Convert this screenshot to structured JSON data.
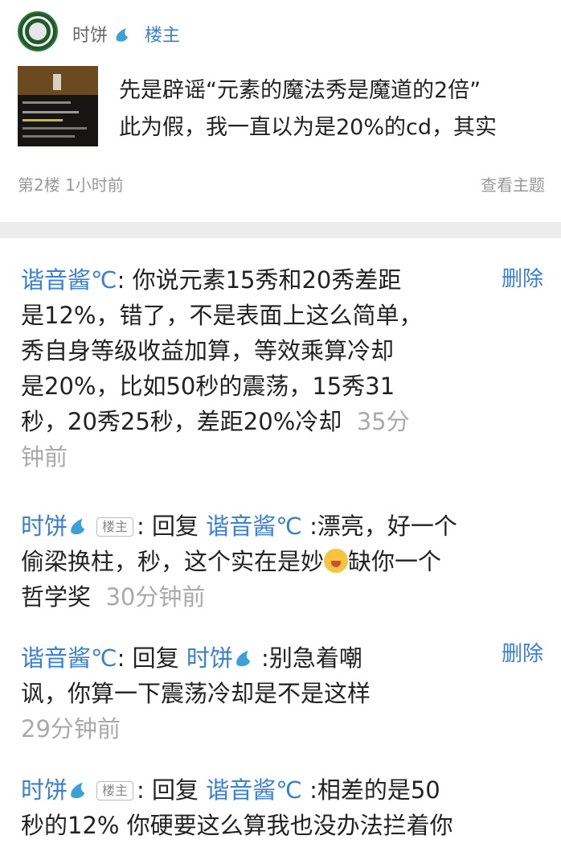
{
  "op": {
    "name": "时饼",
    "louzhu": "楼主",
    "text_lines": [
      "先是辟谣“元素的魔法秀是魔道的2倍”",
      "此为假，我一直以为是20%的cd，其实"
    ],
    "floor_time": "第2楼  1小时前",
    "view_topic": "查看主题"
  },
  "colors": {
    "link": "#3a7fd0",
    "meta": "#999999",
    "divider": "#ececec"
  },
  "replies": [
    {
      "user": "谐音酱℃",
      "lines": [
        "你说元素15秀和20秀差距",
        "是12%，错了，不是表面上这么简单，",
        "秀自身等级收益加算，等效乘算冷却",
        "是20%，比如50秒的震荡，15秀31",
        "秒，20秀25秒，差距20%冷却"
      ],
      "time_a": "35分",
      "time_b": "钟前",
      "delete": "删除"
    },
    {
      "user": "时饼",
      "badge": "楼主",
      "reply_word": "回复",
      "target": "谐音酱℃",
      "line1": ":漂亮，好一个",
      "line2_pre": "偷梁换柱，秒，这个实在是妙",
      "line2_post": "缺你一个",
      "line3": "哲学奖",
      "time": "30分钟前"
    },
    {
      "user": "谐音酱℃",
      "reply_word": "回复",
      "target": "时饼",
      "line1": ":别急着嘲",
      "line2": "讽，你算一下震荡冷却是不是这样",
      "time": "29分钟前",
      "delete": "删除"
    },
    {
      "user": "时饼",
      "badge": "楼主",
      "reply_word": "回复",
      "target": "谐音酱℃",
      "line1": ":相差的是50",
      "line2": "秒的12% 你硬要这么算我也没办法拦着你"
    }
  ]
}
